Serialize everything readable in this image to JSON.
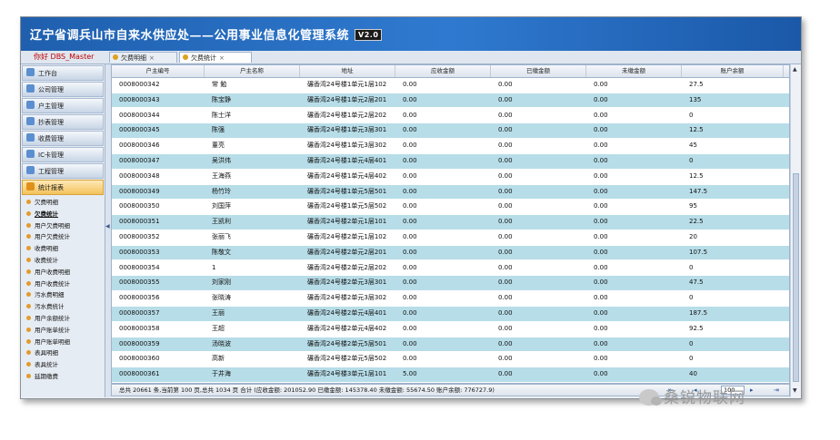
{
  "header": {
    "title": "辽宁省调兵山市自来水供应处——公用事业信息化管理系统",
    "version": "V2.0"
  },
  "user_greeting": "你好 DBS_Master",
  "tabs": [
    {
      "label": "欠费明细",
      "active": false
    },
    {
      "label": "欠费统计",
      "active": true
    }
  ],
  "sidebar": {
    "sections": [
      {
        "label": "工作台",
        "active": false
      },
      {
        "label": "公司管理",
        "active": false
      },
      {
        "label": "户主管理",
        "active": false
      },
      {
        "label": "抄表管理",
        "active": false
      },
      {
        "label": "收费管理",
        "active": false
      },
      {
        "label": "IC卡管理",
        "active": false
      },
      {
        "label": "工程管理",
        "active": false
      },
      {
        "label": "统计报表",
        "active": true
      }
    ],
    "items": [
      "欠费明细",
      "欠费统计",
      "用户欠费明细",
      "用户欠费统计",
      "收费明细",
      "收费统计",
      "用户收费明细",
      "用户收费统计",
      "污水费明细",
      "污水费统计",
      "用户余额统计",
      "用户账单统计",
      "用户账单明细",
      "表具明细",
      "表具统计",
      "延期缴费"
    ],
    "selected_item": 1
  },
  "table": {
    "columns": [
      "户主编号",
      "户主名称",
      "地址",
      "应收金额",
      "已缴金额",
      "未缴金额",
      "账户余额"
    ],
    "rows": [
      [
        "0008000342",
        "常 勉",
        "碾香湾24号楼1单元1层102",
        "0.00",
        "0.00",
        "0.00",
        "27.5"
      ],
      [
        "0008000343",
        "陈宝静",
        "碾香湾24号楼1单元2层201",
        "0.00",
        "0.00",
        "0.00",
        "135"
      ],
      [
        "0008000344",
        "陈士洋",
        "碾香湾24号楼1单元2层202",
        "0.00",
        "0.00",
        "0.00",
        "0"
      ],
      [
        "0008000345",
        "陈强",
        "碾香湾24号楼1单元3层301",
        "0.00",
        "0.00",
        "0.00",
        "12.5"
      ],
      [
        "0008000346",
        "董亮",
        "碾香湾24号楼1单元3层302",
        "0.00",
        "0.00",
        "0.00",
        "45"
      ],
      [
        "0008000347",
        "吴洪伟",
        "碾香湾24号楼1单元4层401",
        "0.00",
        "0.00",
        "0.00",
        "0"
      ],
      [
        "0008000348",
        "王海燕",
        "碾香湾24号楼1单元4层402",
        "0.00",
        "0.00",
        "0.00",
        "12.5"
      ],
      [
        "0008000349",
        "杨竹玲",
        "碾香湾24号楼1单元5层501",
        "0.00",
        "0.00",
        "0.00",
        "147.5"
      ],
      [
        "0008000350",
        "刘国萍",
        "碾香湾24号楼1单元5层502",
        "0.00",
        "0.00",
        "0.00",
        "95"
      ],
      [
        "0008000351",
        "王凯利",
        "碾香湾24号楼2单元1层101",
        "0.00",
        "0.00",
        "0.00",
        "22.5"
      ],
      [
        "0008000352",
        "张丽飞",
        "碾香湾24号楼2单元1层102",
        "0.00",
        "0.00",
        "0.00",
        "20"
      ],
      [
        "0008000353",
        "陈敬文",
        "碾香湾24号楼2单元2层201",
        "0.00",
        "0.00",
        "0.00",
        "107.5"
      ],
      [
        "0008000354",
        "1",
        "碾香湾24号楼2单元2层202",
        "0.00",
        "0.00",
        "0.00",
        "0"
      ],
      [
        "0008000355",
        "刘家刚",
        "碾香湾24号楼2单元3层301",
        "0.00",
        "0.00",
        "0.00",
        "47.5"
      ],
      [
        "0008000356",
        "张晓涛",
        "碾香湾24号楼2单元3层302",
        "0.00",
        "0.00",
        "0.00",
        "0"
      ],
      [
        "0008000357",
        "王丽",
        "碾香湾24号楼2单元4层401",
        "0.00",
        "0.00",
        "0.00",
        "187.5"
      ],
      [
        "0008000358",
        "王超",
        "碾香湾24号楼2单元4层402",
        "0.00",
        "0.00",
        "0.00",
        "92.5"
      ],
      [
        "0008000359",
        "汤晓波",
        "碾香湾24号楼2单元5层501",
        "0.00",
        "0.00",
        "0.00",
        "0"
      ],
      [
        "0008000360",
        "高新",
        "碾香湾24号楼2单元5层502",
        "0.00",
        "0.00",
        "0.00",
        "0"
      ],
      [
        "0008000361",
        "于井海",
        "碾香湾24号楼3单元1层101",
        "5.00",
        "0.00",
        "0.00",
        "40"
      ]
    ]
  },
  "pager": {
    "summary": "总共 20661 条,当前第 100 页,总共 1034 页 合计 (应收金额: 201052.90 已缴金额: 145378.40 未缴金额: 55674.50 账户余额: 776727.9)",
    "first": "⇤",
    "prev": "◂",
    "page_value": "100",
    "next": "▸",
    "last": "⇥"
  },
  "watermark": "桑锐物联网"
}
